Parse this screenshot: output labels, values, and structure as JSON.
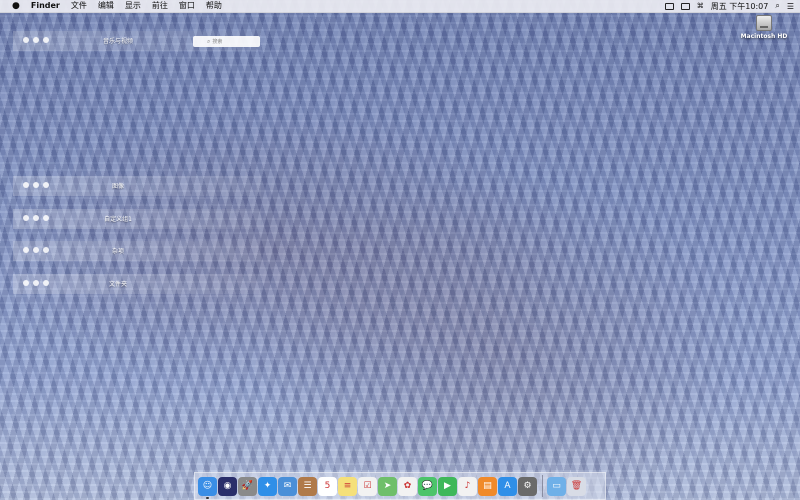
{
  "menubar": {
    "app": "Finder",
    "items": [
      "文件",
      "编辑",
      "显示",
      "前往",
      "窗口",
      "帮助"
    ],
    "clock": "周五 下午10:07"
  },
  "desktop": {
    "hd_label": "Macintosh HD"
  },
  "panels": [
    {
      "title": "音乐与视频"
    },
    {
      "title": "图像"
    },
    {
      "title": "自定义组1"
    },
    {
      "title": "杂项"
    },
    {
      "title": "文件夹"
    }
  ],
  "search": {
    "placeholder": "搜索"
  },
  "dock": {
    "apps": [
      {
        "name": "finder-icon",
        "color": "#3a8ee6",
        "glyph": "☺"
      },
      {
        "name": "siri-icon",
        "color": "#2a2e6a",
        "glyph": "◉"
      },
      {
        "name": "launchpad-icon",
        "color": "#8a8a8a",
        "glyph": "🚀"
      },
      {
        "name": "safari-icon",
        "color": "#2f8fe8",
        "glyph": "✦"
      },
      {
        "name": "mail-icon",
        "color": "#4a8fd8",
        "glyph": "✉"
      },
      {
        "name": "contacts-icon",
        "color": "#b07a4a",
        "glyph": "☰"
      },
      {
        "name": "calendar-icon",
        "color": "#ffffff",
        "glyph": "5"
      },
      {
        "name": "notes-icon",
        "color": "#f5e07a",
        "glyph": "≡"
      },
      {
        "name": "reminders-icon",
        "color": "#f2f2f2",
        "glyph": "☑"
      },
      {
        "name": "maps-icon",
        "color": "#6fbf6a",
        "glyph": "➤"
      },
      {
        "name": "photos-icon",
        "color": "#f2f2f2",
        "glyph": "✿"
      },
      {
        "name": "messages-icon",
        "color": "#4cc46a",
        "glyph": "💬"
      },
      {
        "name": "facetime-icon",
        "color": "#3fb85a",
        "glyph": "▶"
      },
      {
        "name": "itunes-icon",
        "color": "#f2f2f2",
        "glyph": "♪"
      },
      {
        "name": "books-icon",
        "color": "#f08a2a",
        "glyph": "▤"
      },
      {
        "name": "appstore-icon",
        "color": "#2f8fe8",
        "glyph": "A"
      },
      {
        "name": "system-preferences-icon",
        "color": "#6a6a6a",
        "glyph": "⚙"
      }
    ],
    "trailing": [
      {
        "name": "downloads-folder-icon",
        "color": "#6fb0e8",
        "glyph": "▭"
      },
      {
        "name": "trash-icon",
        "color": "#d8dce6",
        "glyph": "🗑"
      }
    ]
  }
}
